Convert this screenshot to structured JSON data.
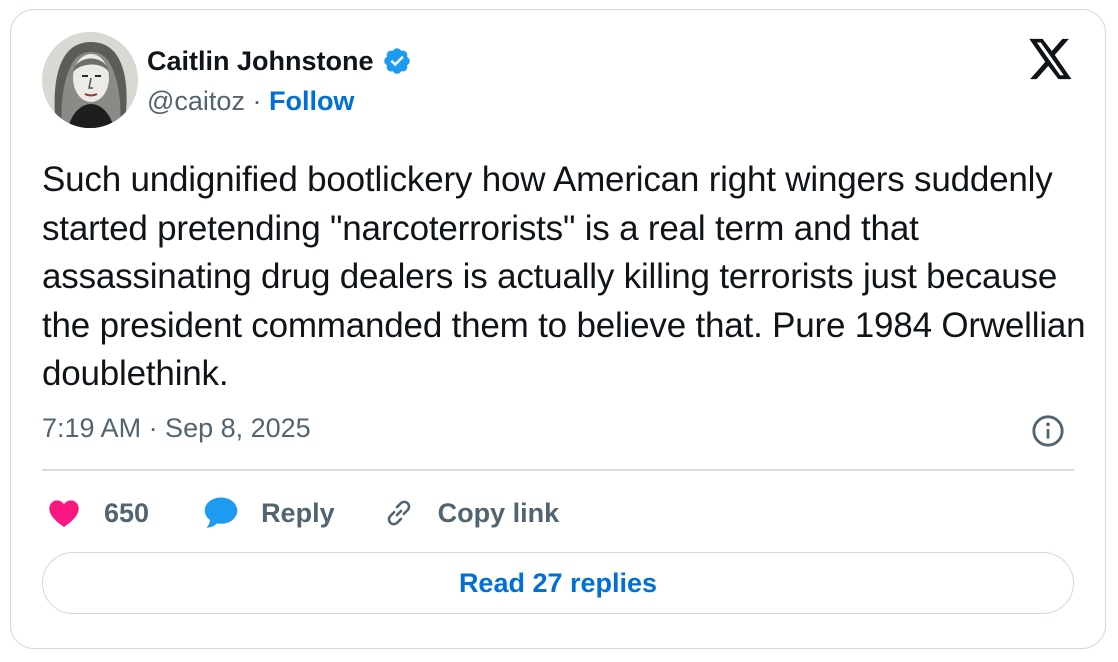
{
  "author": {
    "name": "Caitlin Johnstone",
    "handle": "@caitoz",
    "separator": " · ",
    "follow_label": "Follow",
    "verified": true
  },
  "tweet": {
    "text": "Such undignified bootlickery how American right wingers suddenly started pretending \"narcoterrorists\" is a real term and that assassinating drug dealers is actually killing terrorists just because the president commanded them to believe that. Pure 1984 Orwellian doublethink.",
    "timestamp": "7:19 AM · Sep 8, 2025"
  },
  "actions": {
    "like_count": "650",
    "reply_label": "Reply",
    "copy_link_label": "Copy link"
  },
  "read_replies_label": "Read 27 replies",
  "icons": {
    "brand": "x-logo-icon",
    "verified": "verified-badge-icon",
    "info": "info-icon",
    "like": "heart-icon",
    "reply": "speech-bubble-icon",
    "copy": "link-icon"
  },
  "colors": {
    "text": "#0f1419",
    "secondary": "#536471",
    "link": "#006fd6",
    "like": "#f91880",
    "reply_icon": "#1d9bf0",
    "border": "#cfd9de"
  }
}
